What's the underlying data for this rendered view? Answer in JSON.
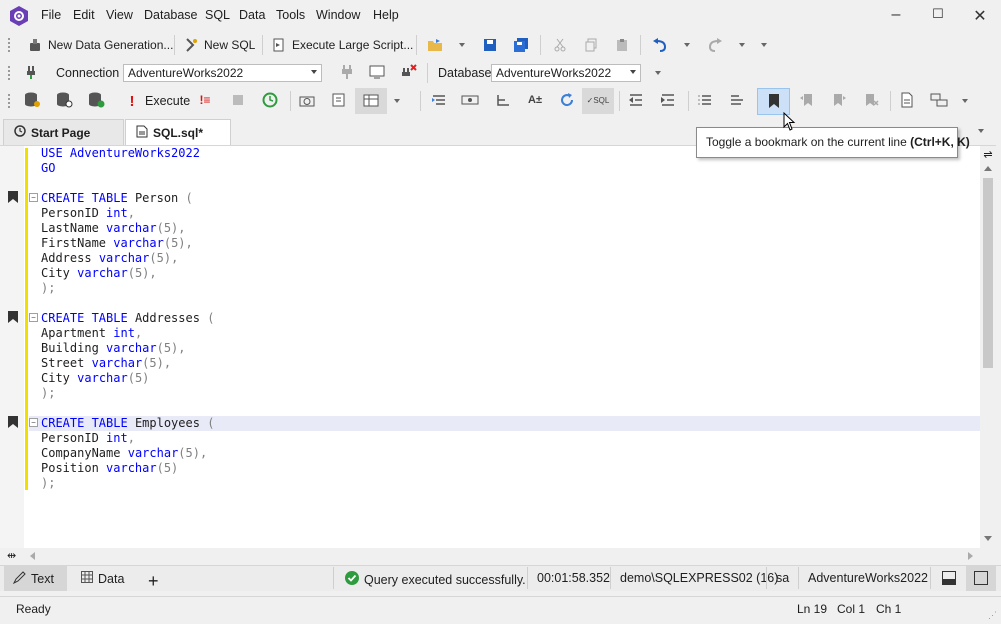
{
  "menu": [
    "File",
    "Edit",
    "View",
    "Database",
    "SQL",
    "Data",
    "Tools",
    "Window",
    "Help"
  ],
  "toolbar1": {
    "new_data_generation": "New Data Generation...",
    "new_sql": "New SQL",
    "execute_large_script": "Execute Large Script..."
  },
  "toolbar2": {
    "connection_label": "Connection",
    "connection_value": "AdventureWorks2022",
    "database_label": "Database",
    "database_value": "AdventureWorks2022"
  },
  "toolbar3": {
    "execute_label": "Execute"
  },
  "tabs": [
    {
      "label": "Start Page"
    },
    {
      "label": "SQL.sql*"
    }
  ],
  "tooltip": {
    "text": "Toggle a bookmark on the current line ",
    "shortcut": "(Ctrl+K, K)"
  },
  "code": {
    "l1": "USE AdventureWorks2022",
    "l2": "GO",
    "create_table": "CREATE TABLE",
    "person": "Person",
    "addresses": "Addresses",
    "employees": "Employees",
    "open_paren": "(",
    "close": ");",
    "varchar5": "varchar",
    "int": "int",
    "five": "(5)",
    "comma": ",",
    "cols": {
      "personid": "PersonID",
      "lastname": "LastName",
      "firstname": "FirstName",
      "address": "Address",
      "city": "City",
      "apartment": "Apartment",
      "building": "Building",
      "street": "Street",
      "companyname": "CompanyName",
      "position": "Position"
    }
  },
  "results": {
    "text_tab": "Text",
    "data_tab": "Data",
    "status": "Query executed successfully.",
    "elapsed": "00:01:58.352",
    "server": "demo\\SQLEXPRESS02 (16)",
    "user": "sa",
    "database": "AdventureWorks2022"
  },
  "statusbar": {
    "ready": "Ready",
    "ln": "Ln 19",
    "col": "Col 1",
    "ch": "Ch 1"
  },
  "colors": {
    "keyword": "#0000ff",
    "change_bar": "#f0e000",
    "success": "#2e9b3f",
    "logo": "#6a3fb5"
  }
}
